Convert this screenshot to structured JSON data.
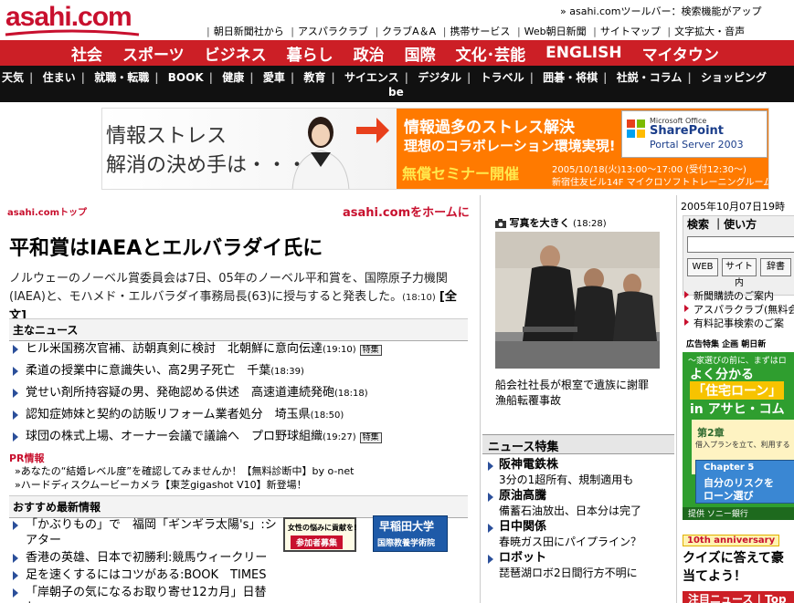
{
  "colors": {
    "brand_red": "#cc1f26",
    "nav_black": "#111111",
    "link_blue": "#2b4f9a",
    "banner_orange": "#ff7a00"
  },
  "header": {
    "logo": "asahi.com",
    "toolbar": "» asahi.comツールバー：検索機能がアップ",
    "links": [
      "朝日新聞社から",
      "アスパラクラブ",
      "クラブA＆A",
      "携帯サービス",
      "Web朝日新聞",
      "サイトマップ",
      "文字拡大・音声"
    ]
  },
  "mainnav": [
    "社会",
    "スポーツ",
    "ビジネス",
    "暮らし",
    "政治",
    "国際",
    "文化･芸能",
    "ENGLISH",
    "マイタウン"
  ],
  "subnav": {
    "row1": [
      "天気",
      "住まい",
      "就職・転職",
      "BOOK",
      "健康",
      "愛車",
      "教育",
      "サイエンス",
      "デジタル",
      "トラベル",
      "囲碁・将棋",
      "社説・コラム",
      "ショッピング"
    ],
    "row2": "be"
  },
  "banner": {
    "left_line1": "情報ストレス",
    "left_line2": "解消の決め手は・・・",
    "title": "情報過多のストレス解決",
    "subtitle": "理想のコラボレーション環境実現!",
    "seminar": "無償セミナー開催",
    "date": "2005/10/18(火)13:00～17:00 (受付12:30～)",
    "place": "新宿住友ビル14F マイクロソフトトレーニングルーム",
    "ms": "Microsoft Office",
    "product1": "SharePoint",
    "product2": "Portal Server 2003"
  },
  "main": {
    "crumb": "asahi.comトップ",
    "home_link": "asahi.comをホームに",
    "headline": "平和賞はIAEAとエルバラダイ氏に",
    "lead": "ノルウェーのノーベル賞委員会は7日、05年のノーベル平和賞を、国際原子力機関(IAEA)と、モハメド・エルバラダイ事務局長(63)に授与すると発表した。",
    "lead_time": "(18:10)",
    "lead_full": "[全文]",
    "news_head": "主なニュース",
    "news": [
      {
        "text": "ヒル米国務次官補、訪朝真剣に検討　北朝鮮に意向伝達",
        "time": "(19:10)",
        "badge": "特集"
      },
      {
        "text": "柔道の授業中に意識失い、高2男子死亡　千葉",
        "time": "(18:39)",
        "badge": ""
      },
      {
        "text": "覚せい剤所持容疑の男、発砲認める供述　高速道連続発砲",
        "time": "(18:18)",
        "badge": ""
      },
      {
        "text": "認知症姉妹と契約の訪販リフォーム業者処分　埼玉県",
        "time": "(18:50)",
        "badge": ""
      },
      {
        "text": "球団の株式上場、オーナー会議で議論へ　プロ野球組織",
        "time": "(19:27)",
        "badge": "特集"
      }
    ],
    "pr_head": "PR情報",
    "pr": [
      "»あなたの“結婚レベル度”を確認してみませんか！【無料診断中】by o-net",
      "»ハードディスクムービーカメラ【東芝gigashot V10】新登場！"
    ],
    "rec_head": "おすすめ最新情報",
    "rec": [
      "「かぶりもの」で　福岡「ギンギラ太陽's」:シアター",
      "香港の英雄、日本で初勝利:競馬ウィークリー",
      "足を速くするにはコツがある:BOOK　TIMES",
      "「岸朝子の気になるお取り寄せ12カ月」日替わ"
    ],
    "ad1_line1": "女性の悩みに貢献を!",
    "ad1_line2": "参加者募集",
    "ad2_line1": "早稲田大学",
    "ad2_line2": "国際教養学術院"
  },
  "photo": {
    "link": "写真を大きく",
    "time": "(18:28)",
    "caption": "船会社社長が根室で遺族に謝罪　漁船転覆事故"
  },
  "feature": {
    "head": "ニュース特集",
    "items": [
      {
        "title": "阪神電鉄株",
        "sub": "3分の1超所有、規制適用も"
      },
      {
        "title": "原油高騰",
        "sub": "備蓄石油放出、日本分は完了"
      },
      {
        "title": "日中関係",
        "sub": "春暁ガス田にパイプライン？"
      },
      {
        "title": "ロボット",
        "sub": "琵琶湖ロボ2日間行方不明に"
      }
    ]
  },
  "sidebar": {
    "date": "2005年10月07日19時",
    "search_label": "検索 ｜使い方",
    "search_value": "",
    "btn_web": "WEB",
    "btn_site": "サイト内",
    "btn_dict": "辞書",
    "links": [
      "新聞購読のご案内",
      "アスパラクラブ(無料会",
      "有料記事検索のご案"
    ],
    "ad_top": "広告特集 企画 朝日新",
    "ad_l1": "〜家選びの前に、まずはロ",
    "ad_l2": "よく分かる",
    "ad_l3": "「住宅ローン」",
    "ad_l4": "in アサヒ・コム",
    "ad_b1": "第2章",
    "ad_b2": "借入プランを立て、利用する",
    "ad_c1": "Chapter 5",
    "ad_c2": "自分のリスクを",
    "ad_c3": "ローン選び",
    "ad_bar": "提供 ソニー銀行",
    "quiz_badge": "10th anniversary",
    "quiz1": "クイズに答えて豪",
    "quiz2": "当てよう！",
    "news_head": "注目ニュース | Top"
  }
}
